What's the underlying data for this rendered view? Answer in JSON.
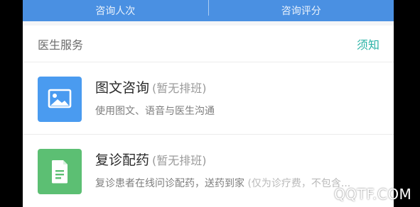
{
  "stats_bar": {
    "consult_count_label": "咨询人次",
    "consult_rating_label": "咨询评分",
    "background_color": "#4a90e2"
  },
  "section": {
    "title": "医生服务",
    "notice_link": "须知",
    "notice_color": "#2bb3a6"
  },
  "services": [
    {
      "title": "图文咨询",
      "status": "(暂无排班)",
      "description": "使用图文、语音与医生沟通",
      "description_note": "",
      "icon": "image-icon",
      "icon_color": "#4a9bf0"
    },
    {
      "title": "复诊配药",
      "status": "(暂无排班)",
      "description": "复诊患者在线问诊配药，送药到家",
      "description_note": " (仅为诊疗费，不包含...",
      "icon": "document-icon",
      "icon_color": "#5cbf73"
    }
  ],
  "watermark": "QQTF.COM"
}
